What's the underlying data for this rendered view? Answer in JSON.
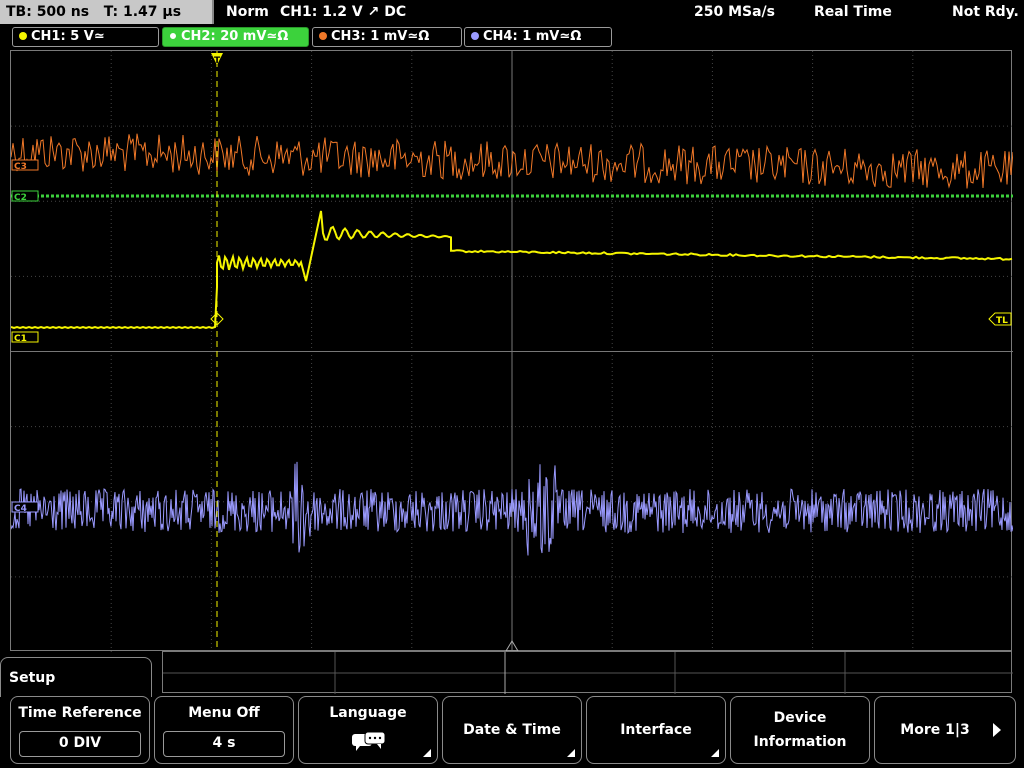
{
  "status": {
    "timebase": "TB: 500 ns",
    "trigger_time": "T: 1.47 µs",
    "mode": "Norm",
    "trigger_info": "CH1: 1.2 V ↗ DC",
    "sample_rate": "250 MSa/s",
    "acq_mode": "Real Time",
    "state": "Not Rdy."
  },
  "channels": [
    {
      "label": "CH1: 5 V≃",
      "color": "#f5f500",
      "active": false
    },
    {
      "label": "CH2: 20 mV≃Ω",
      "color": "#3cd23c",
      "active": true
    },
    {
      "label": "CH3: 1 mV≃Ω",
      "color": "#f07828",
      "active": false
    },
    {
      "label": "CH4: 1 mV≃Ω",
      "color": "#9a9aff",
      "active": false
    }
  ],
  "markers": {
    "c1": "C1",
    "c2": "C2",
    "c3": "C3",
    "c4": "C4",
    "tl": "TL",
    "trigger": "T"
  },
  "menu": {
    "title": "Setup",
    "softkeys": [
      {
        "label": "Time Reference",
        "value": "0 DIV"
      },
      {
        "label": "Menu Off",
        "value": "4 s"
      },
      {
        "label": "Language",
        "icon": "speech-bubbles-icon"
      },
      {
        "label": "Date & Time"
      },
      {
        "label": "Interface"
      },
      {
        "label": "Device Information"
      },
      {
        "label": "More 1|3"
      }
    ]
  }
}
